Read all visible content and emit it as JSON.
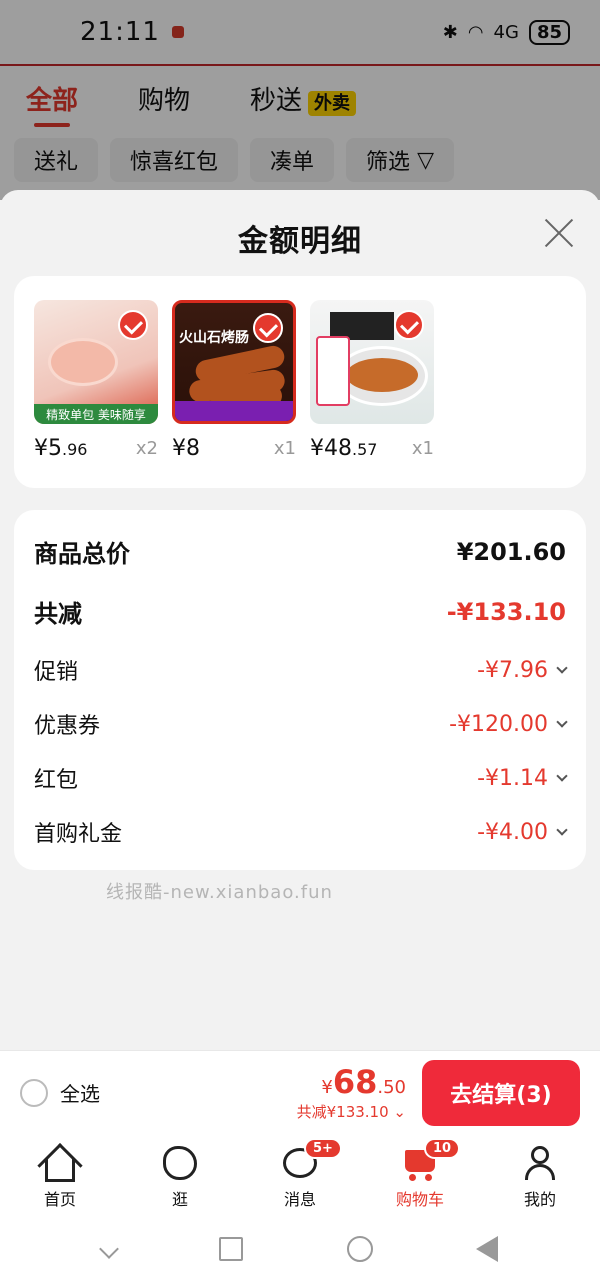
{
  "status_bar": {
    "time": "21:11",
    "battery": "85",
    "network": "4G"
  },
  "top_tabs": [
    {
      "label": "全部",
      "active": true
    },
    {
      "label": "购物",
      "active": false
    },
    {
      "label": "秒送",
      "active": false,
      "badge": "外卖"
    }
  ],
  "filter_chips": [
    "送礼",
    "惊喜红包",
    "凑单",
    "筛选"
  ],
  "sheet": {
    "title": "金额明细",
    "products": [
      {
        "price_int": "¥5",
        "price_frac": ".96",
        "qty": "x2",
        "banner": "精致单包 美味随享"
      },
      {
        "price_int": "¥8",
        "price_frac": "",
        "qty": "x1",
        "banner": "火山石烤肠"
      },
      {
        "price_int": "¥48",
        "price_frac": ".57",
        "qty": "x1",
        "banner": ""
      }
    ],
    "rows": [
      {
        "label": "商品总价",
        "value": "¥201.60"
      },
      {
        "label": "共减",
        "value": "-¥133.10"
      },
      {
        "label": "促销",
        "value": "-¥7.96"
      },
      {
        "label": "优惠券",
        "value": "-¥120.00"
      },
      {
        "label": "红包",
        "value": "-¥1.14"
      },
      {
        "label": "首购礼金",
        "value": "-¥4.00"
      }
    ]
  },
  "watermark": "线报酷-new.xianbao.fun",
  "checkout": {
    "select_all": "全选",
    "pay_symbol": "¥",
    "pay_int": "68",
    "pay_frac": ".50",
    "discount_text": "共减¥133.10",
    "settle_label": "去结算(3)"
  },
  "bottom_nav": [
    {
      "label": "首页",
      "icon": "home-icon"
    },
    {
      "label": "逛",
      "icon": "browse-icon"
    },
    {
      "label": "消息",
      "icon": "message-icon",
      "badge": "5+"
    },
    {
      "label": "购物车",
      "icon": "cart-icon",
      "badge": "10",
      "active": true
    },
    {
      "label": "我的",
      "icon": "user-icon"
    }
  ],
  "colors": {
    "accent": "#e4392e",
    "button": "#ef2a3a"
  }
}
